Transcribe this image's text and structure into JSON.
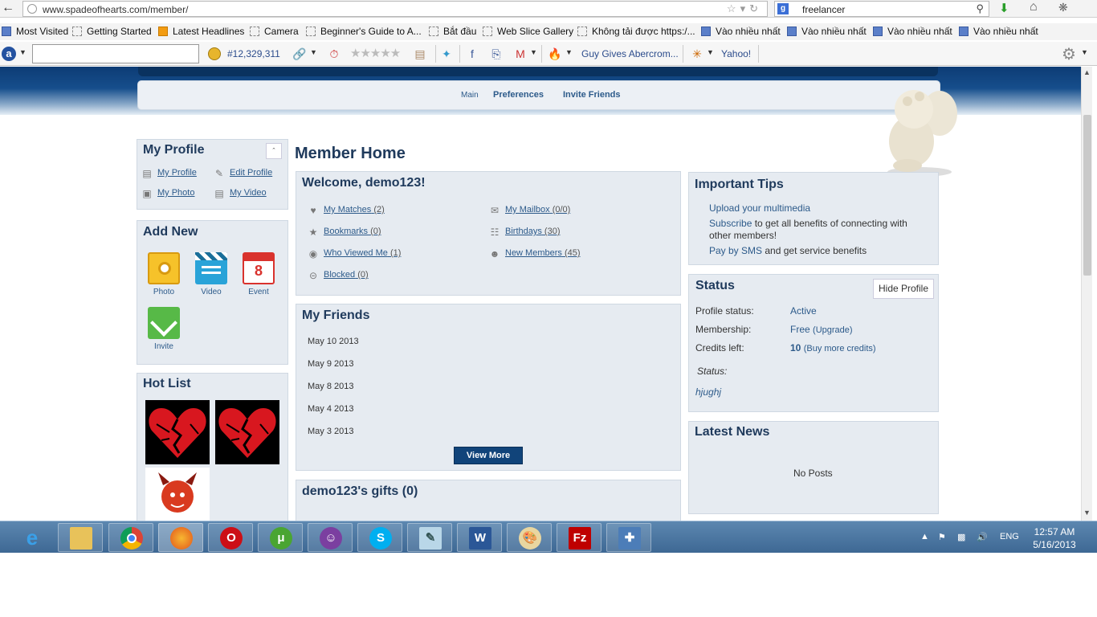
{
  "browser": {
    "url": "www.spadeofhearts.com/member/",
    "search_value": "freelancer",
    "bookmarks": [
      "Most Visited",
      "Getting Started",
      "Latest Headlines",
      "Camera",
      "Beginner's Guide to A...",
      "Bắt đầu",
      "Web Slice Gallery",
      "Không tải được https:/...",
      "Vào nhiều nhất",
      "Vào nhiều nhất",
      "Vào nhiều nhất",
      "Vào nhiều nhất"
    ]
  },
  "toolbar": {
    "alexa_rank": "#12,329,311",
    "link1": "Guy Gives Abercrom...",
    "link2": "Yahoo!"
  },
  "subnav": {
    "main": "Main",
    "preferences": "Preferences",
    "invite": "Invite Friends"
  },
  "profile": {
    "title": "My Profile",
    "links": [
      "My Profile",
      "Edit Profile",
      "My Photo",
      "My Video"
    ]
  },
  "add_new": {
    "title": "Add New",
    "items": [
      "Photo",
      "Video",
      "Event",
      "Invite"
    ],
    "event_day": "8"
  },
  "hot_list": {
    "title": "Hot List"
  },
  "member_home": {
    "title": "Member Home"
  },
  "welcome": {
    "title": "Welcome, demo123!",
    "items": [
      {
        "label": "My Matches",
        "count": "(2)"
      },
      {
        "label": "My Mailbox",
        "count": "(0/0)"
      },
      {
        "label": "Bookmarks",
        "count": "(0)"
      },
      {
        "label": "Birthdays",
        "count": "(30)"
      },
      {
        "label": "Who Viewed Me",
        "count": "(1)"
      },
      {
        "label": "New Members",
        "count": "(45)"
      },
      {
        "label": "Blocked",
        "count": "(0)"
      }
    ]
  },
  "friends": {
    "title": "My Friends",
    "dates": [
      "May 10 2013",
      "May 9 2013",
      "May 8 2013",
      "May 4 2013",
      "May 3 2013"
    ],
    "button": "View More"
  },
  "gifts": {
    "title": "demo123's gifts (0)"
  },
  "tips": {
    "title": "Important Tips",
    "line1": "Upload your multimedia",
    "line2_link": "Subscribe",
    "line2_rest": " to get all benefits of connecting with",
    "line3": "other members!",
    "line4_link": "Pay by SMS",
    "line4_rest": " and get service benefits"
  },
  "status": {
    "title": "Status",
    "hide_button": "Hide Profile",
    "profile_label": "Profile status:",
    "profile_value": "Active",
    "membership_label": "Membership:",
    "membership_value": "Free",
    "membership_extra": "(Upgrade)",
    "credits_label": "Credits left:",
    "credits_value": "10",
    "credits_extra": "(Buy more credits)",
    "status_label": "Status:",
    "status_value": "hjughj"
  },
  "news": {
    "title": "Latest News",
    "empty": "No Posts"
  },
  "taskbar": {
    "lang": "ENG",
    "time": "12:57 AM",
    "date": "5/16/2013"
  }
}
